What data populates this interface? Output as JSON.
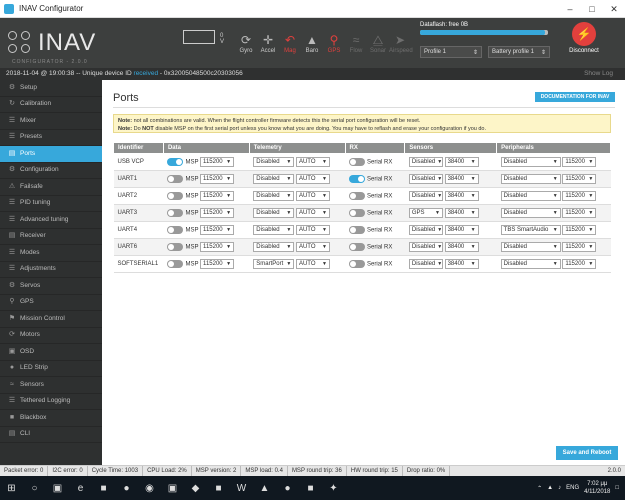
{
  "window": {
    "title": "INAV Configurator"
  },
  "logo": {
    "name": "INAV",
    "sub": "CONFIGURATOR - 2.0.0"
  },
  "battery": {
    "voltage": "0 V"
  },
  "sensors": [
    {
      "label": "Gyro",
      "icon": "gyro-icon",
      "state": "ok"
    },
    {
      "label": "Accel",
      "icon": "accel-icon",
      "state": "ok"
    },
    {
      "label": "Mag",
      "icon": "mag-icon",
      "state": "error"
    },
    {
      "label": "Baro",
      "icon": "baro-icon",
      "state": "ok"
    },
    {
      "label": "GPS",
      "icon": "gps-icon",
      "state": "error"
    },
    {
      "label": "Flow",
      "icon": "flow-icon",
      "state": "inactive"
    },
    {
      "label": "Sonar",
      "icon": "sonar-icon",
      "state": "inactive"
    },
    {
      "label": "Airspeed",
      "icon": "airspeed-icon",
      "state": "inactive"
    }
  ],
  "dataflash": {
    "label": "Dataflash: free 0B",
    "fill": 0.98
  },
  "profiles": {
    "profile": "Profile 1",
    "battery_profile": "Battery profile 1"
  },
  "disconnect": {
    "label": "Disconnect"
  },
  "statusline": {
    "date": "2018-11-04 @ 19:00:38 -- Unique device ID",
    "received": "received",
    "device_id": "- 0x32005048500c20303056",
    "show_log": "Show Log"
  },
  "nav": [
    {
      "label": "Setup",
      "icon": "gear-icon"
    },
    {
      "label": "Calibration",
      "icon": "calibration-icon"
    },
    {
      "label": "Mixer",
      "icon": "mixer-icon"
    },
    {
      "label": "Presets",
      "icon": "presets-icon"
    },
    {
      "label": "Ports",
      "icon": "ports-icon",
      "active": true
    },
    {
      "label": "Configuration",
      "icon": "configuration-icon"
    },
    {
      "label": "Failsafe",
      "icon": "failsafe-icon"
    },
    {
      "label": "PID tuning",
      "icon": "pid-icon"
    },
    {
      "label": "Advanced tuning",
      "icon": "advanced-icon"
    },
    {
      "label": "Receiver",
      "icon": "receiver-icon"
    },
    {
      "label": "Modes",
      "icon": "modes-icon"
    },
    {
      "label": "Adjustments",
      "icon": "adjustments-icon"
    },
    {
      "label": "Servos",
      "icon": "servos-icon"
    },
    {
      "label": "GPS",
      "icon": "gps-icon"
    },
    {
      "label": "Mission Control",
      "icon": "mission-icon"
    },
    {
      "label": "Motors",
      "icon": "motors-icon"
    },
    {
      "label": "OSD",
      "icon": "osd-icon"
    },
    {
      "label": "LED Strip",
      "icon": "led-icon"
    },
    {
      "label": "Sensors",
      "icon": "sensors-icon"
    },
    {
      "label": "Tethered Logging",
      "icon": "logging-icon"
    },
    {
      "label": "Blackbox",
      "icon": "blackbox-icon"
    },
    {
      "label": "CLI",
      "icon": "cli-icon"
    }
  ],
  "page": {
    "title": "Ports",
    "doc_button": "DOCUMENTATION FOR INAV",
    "save_button": "Save and Reboot"
  },
  "note": {
    "line1_label": "Note:",
    "line1": "not all combinations are valid. When the flight controller firmware detects this the serial port configuration will be reset.",
    "line2_label": "Note:",
    "line2_a": "Do",
    "line2_not": "NOT",
    "line2_b": "disable MSP on the first serial port unless you know what you are doing. You may have to reflash and erase your configuration if you do."
  },
  "table": {
    "headers": [
      "Identifier",
      "Data",
      "Telemetry",
      "RX",
      "Sensors",
      "Peripherals"
    ],
    "rows": [
      {
        "id": "USB VCP",
        "msp_on": true,
        "msp_label": "MSP",
        "msp_baud": "115200",
        "telem": "Disabled",
        "telem_baud": "AUTO",
        "rx_on": false,
        "rx_label": "Serial RX",
        "sensor": "Disabled",
        "sensor_baud": "38400",
        "periph": "Disabled",
        "periph_baud": "115200"
      },
      {
        "id": "UART1",
        "msp_on": false,
        "msp_label": "MSP",
        "msp_baud": "115200",
        "telem": "Disabled",
        "telem_baud": "AUTO",
        "rx_on": true,
        "rx_label": "Serial RX",
        "sensor": "Disabled",
        "sensor_baud": "38400",
        "periph": "Disabled",
        "periph_baud": "115200"
      },
      {
        "id": "UART2",
        "msp_on": false,
        "msp_label": "MSP",
        "msp_baud": "115200",
        "telem": "Disabled",
        "telem_baud": "AUTO",
        "rx_on": false,
        "rx_label": "Serial RX",
        "sensor": "Disabled",
        "sensor_baud": "38400",
        "periph": "Disabled",
        "periph_baud": "115200"
      },
      {
        "id": "UART3",
        "msp_on": false,
        "msp_label": "MSP",
        "msp_baud": "115200",
        "telem": "Disabled",
        "telem_baud": "AUTO",
        "rx_on": false,
        "rx_label": "Serial RX",
        "sensor": "GPS",
        "sensor_baud": "38400",
        "periph": "Disabled",
        "periph_baud": "115200"
      },
      {
        "id": "UART4",
        "msp_on": false,
        "msp_label": "MSP",
        "msp_baud": "115200",
        "telem": "Disabled",
        "telem_baud": "AUTO",
        "rx_on": false,
        "rx_label": "Serial RX",
        "sensor": "Disabled",
        "sensor_baud": "38400",
        "periph": "TBS SmartAudio",
        "periph_baud": "115200"
      },
      {
        "id": "UART6",
        "msp_on": false,
        "msp_label": "MSP",
        "msp_baud": "115200",
        "telem": "Disabled",
        "telem_baud": "AUTO",
        "rx_on": false,
        "rx_label": "Serial RX",
        "sensor": "Disabled",
        "sensor_baud": "38400",
        "periph": "Disabled",
        "periph_baud": "115200"
      },
      {
        "id": "SOFTSERIAL1",
        "msp_on": false,
        "msp_label": "MSP",
        "msp_baud": "115200",
        "telem": "SmartPort",
        "telem_baud": "AUTO",
        "rx_on": false,
        "rx_label": "Serial RX",
        "sensor": "Disabled",
        "sensor_baud": "38400",
        "periph": "Disabled",
        "periph_baud": "115200"
      }
    ]
  },
  "statusbar": [
    "Packet error: 0",
    "I2C error: 0",
    "Cycle Time: 1003",
    "CPU Load: 2%",
    "MSP version: 2",
    "MSP load: 0.4",
    "MSP round trip: 36",
    "HW round trip: 15",
    "Drop ratio: 0%"
  ],
  "version": "2.0.0",
  "taskbar": {
    "lang": "ENG",
    "time": "7:02 μμ",
    "date": "4/11/2018"
  }
}
